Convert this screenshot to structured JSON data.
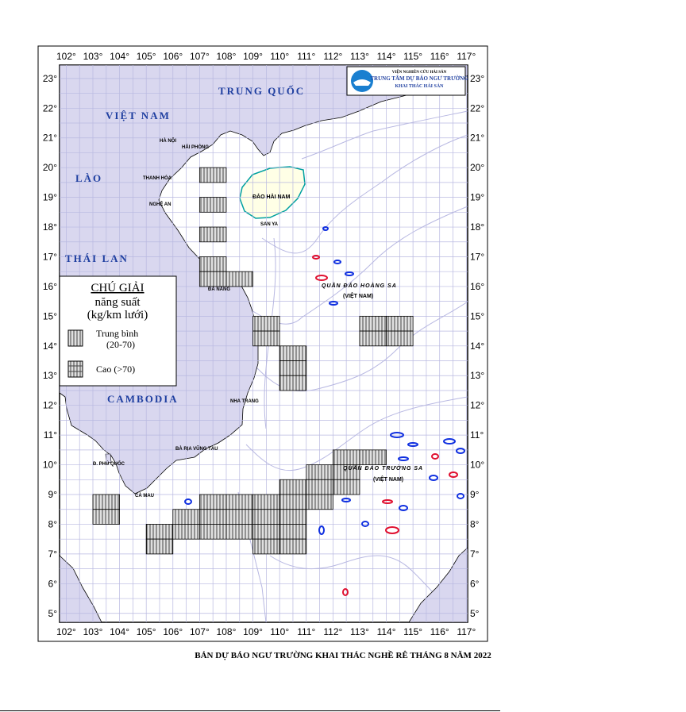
{
  "map": {
    "lon_labels": [
      "102°",
      "103°",
      "104°",
      "105°",
      "106°",
      "107°",
      "108°",
      "109°",
      "110°",
      "111°",
      "112°",
      "113°",
      "114°",
      "115°",
      "116°",
      "117°"
    ],
    "lat_labels": [
      "23°",
      "22°",
      "21°",
      "20°",
      "19°",
      "18°",
      "17°",
      "16°",
      "15°",
      "14°",
      "13°",
      "12°",
      "11°",
      "10°",
      "9°",
      "8°",
      "7°",
      "6°",
      "5°"
    ],
    "colors": {
      "land": "#d9d7ef",
      "sea": "#ffffff",
      "grid": "#b8b8e0",
      "depth": "#9a9ad6",
      "hainan": "#ffffe6",
      "hainan_coast": "#00a0a0",
      "country_label": "#1f3fa0",
      "reef_blue": "#1030e0",
      "reef_red": "#e01030"
    }
  },
  "labels": {
    "countries": {
      "trung_quoc": "TRUNG QUỐC",
      "viet_nam": "VIỆT NAM",
      "lao": "LÀO",
      "thai_lan": "THÁI LAN",
      "cambodia": "CAMBODIA"
    },
    "places": {
      "ha_noi": "HÀ NỘI",
      "hai_phong": "HẢI PHÒNG",
      "thanh_hoa": "THANH HÓA",
      "nghe_an": "NGHỆ AN",
      "da_nang": "ĐÀ NẴNG",
      "nha_trang": "NHA TRANG",
      "ba_ria_vung_tau": "BÀ RỊA VŨNG TÀU",
      "ca_mau": "CÀ MAU",
      "phu_quoc": "Đ. PHÚ QUỐC",
      "san_ya": "SAN YA",
      "dao_hai_nam": "ĐẢO HẢI NAM"
    },
    "islands": {
      "hoang_sa": "QUẦN ĐẢO HOÀNG SA",
      "hoang_sa_vn": "(VIỆT NAM)",
      "truong_sa": "QUẦN ĐẢO TRƯỜNG SA",
      "truong_sa_vn": "(VIỆT NAM)"
    }
  },
  "logo": {
    "line1": "VIỆN NGHIÊN CỨU HẢI SẢN",
    "line2": "TRUNG TÂM DỰ BÁO NGƯ TRƯỜNG",
    "line3": "KHAI THÁC HẢI SẢN"
  },
  "legend": {
    "title": "CHÚ GIẢI",
    "subtitle1": "năng suất",
    "subtitle2": "(kg/km lưới)",
    "item1_label": "Trung bình",
    "item1_range": "(20-70)",
    "item2_label": "Cao (>70)"
  },
  "forecast_cells": {
    "medium": [
      [
        107,
        20
      ],
      [
        107,
        19
      ],
      [
        107,
        18
      ],
      [
        107,
        17
      ],
      [
        107,
        16.5
      ],
      [
        108,
        16.5
      ],
      [
        109,
        15
      ],
      [
        109,
        14.5
      ],
      [
        110,
        14
      ],
      [
        110,
        13.5
      ],
      [
        110,
        13
      ],
      [
        113,
        15
      ],
      [
        113,
        14.5
      ],
      [
        114,
        15
      ],
      [
        114,
        14.5
      ],
      [
        111,
        10
      ],
      [
        112,
        10
      ],
      [
        112,
        9.5
      ],
      [
        103,
        9
      ],
      [
        103,
        8.5
      ],
      [
        105,
        8
      ],
      [
        105,
        7.5
      ],
      [
        106,
        8.5
      ],
      [
        106,
        8
      ],
      [
        107,
        9
      ],
      [
        107,
        8.5
      ],
      [
        107,
        8
      ],
      [
        108,
        9
      ],
      [
        108,
        8.5
      ],
      [
        108,
        8
      ],
      [
        109,
        9
      ],
      [
        109,
        8.5
      ],
      [
        109,
        8
      ],
      [
        109,
        7.5
      ],
      [
        110,
        9.5
      ],
      [
        110,
        9
      ],
      [
        110,
        8.5
      ],
      [
        110,
        8
      ],
      [
        110,
        7.5
      ],
      [
        111,
        9.5
      ],
      [
        111,
        9
      ],
      [
        112,
        10.5
      ],
      [
        113,
        10.5
      ]
    ]
  },
  "caption": "BẢN DỰ BÁO NGƯ TRƯỜNG KHAI THÁC NGHỀ RÊ THÁNG 8 NĂM 2022"
}
